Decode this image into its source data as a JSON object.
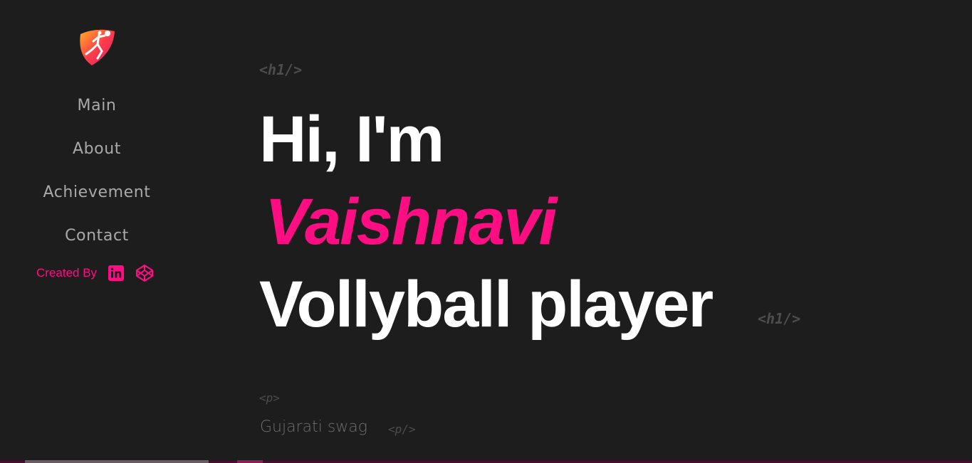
{
  "logo": {
    "icon": "volleyball-player-icon"
  },
  "nav": {
    "items": [
      {
        "label": "Main"
      },
      {
        "label": "About"
      },
      {
        "label": "Achievement"
      },
      {
        "label": "Contact"
      }
    ]
  },
  "created": {
    "label": "Created By",
    "icons": [
      "linkedin-icon",
      "codepen-icon"
    ],
    "color": "#ff0e83"
  },
  "hero": {
    "tag_open": "<h1/>",
    "line1": "Hi, I'm",
    "line2": "Vaishnavi",
    "line3": "Vollyball player",
    "tag_close": "<h1/>",
    "accent": "#ff0e83"
  },
  "paragraph": {
    "tag_open": "<p>",
    "text": "Gujarati swag",
    "tag_close": "<p/>"
  }
}
